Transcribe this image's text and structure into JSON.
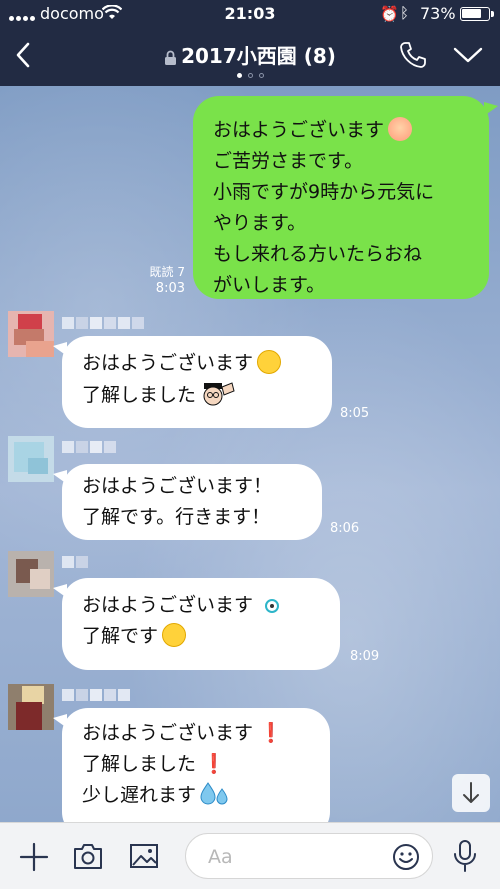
{
  "status": {
    "carrier": "docomo",
    "time": "21:03",
    "battery": "73%",
    "battery_level": 0.73
  },
  "header": {
    "title": "2017小西園 (8)",
    "page_dots": 3,
    "active_dot": 0
  },
  "messages": [
    {
      "sender": "me",
      "lines": [
        "おはようございます",
        "ご苦労さまです。",
        "小雨ですが9時から元気に",
        "やります。",
        "もし来れる方いたらおね",
        "がいします。"
      ],
      "read_label": "既読 7",
      "time": "8:03"
    },
    {
      "sender": "other",
      "lines": [
        "おはようございます",
        "了解しました"
      ],
      "time": "8:05"
    },
    {
      "sender": "other",
      "lines": [
        "おはようございます！",
        "了解です。行きます！"
      ],
      "time": "8:06"
    },
    {
      "sender": "other",
      "lines": [
        "おはようございます",
        "了解です"
      ],
      "time": "8:09"
    },
    {
      "sender": "other",
      "lines": [
        "おはようございます",
        "了解しました",
        "少し遅れます"
      ],
      "time": ""
    }
  ],
  "emoji_exclaim": "❗",
  "input": {
    "placeholder": "Aa"
  },
  "colors": {
    "header_bg": "#222b43",
    "my_bubble": "#7ae24a",
    "their_bubble": "#ffffff",
    "chat_bg": "#8fa8cc"
  },
  "icons": [
    "back-icon",
    "lock-icon",
    "phone-icon",
    "chevron-down-icon",
    "plus-icon",
    "camera-icon",
    "image-icon",
    "emoji-icon",
    "microphone-icon",
    "arrow-down-icon"
  ]
}
